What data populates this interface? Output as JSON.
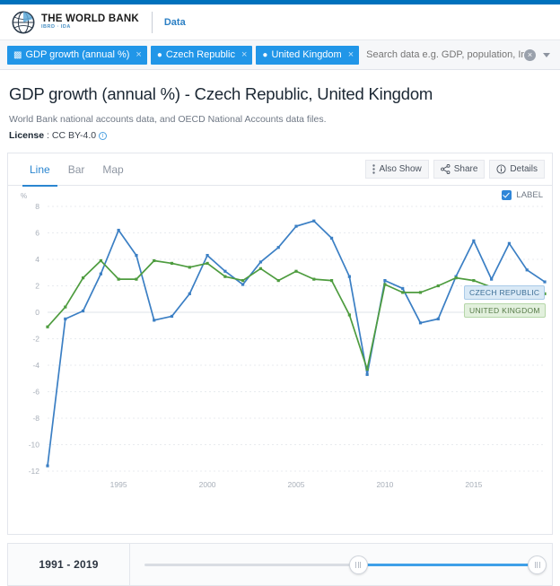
{
  "brand": {
    "logo_icon": "world-bank-globe-icon",
    "title": "THE WORLD BANK",
    "subtitle": "IBRD · IDA",
    "data_link": "Data"
  },
  "search": {
    "tokens": [
      {
        "icon": "bar-chart-icon",
        "label": "GDP growth (annual %)",
        "remove": "×"
      },
      {
        "icon": "location-pin-icon",
        "label": "Czech Republic",
        "remove": "×"
      },
      {
        "icon": "location-pin-icon",
        "label": "United Kingdom",
        "remove": "×"
      }
    ],
    "placeholder": "Search data e.g. GDP, population, India",
    "value": "",
    "clear_label": "×",
    "accent": "#2196e8"
  },
  "heading": {
    "title": "GDP growth (annual %) - Czech Republic, United Kingdom",
    "source": "World Bank national accounts data, and OECD National Accounts data files.",
    "license_label": "License",
    "license_sep": " : ",
    "license_value": "CC BY-4.0",
    "info_icon": "info-icon"
  },
  "card": {
    "tabs": [
      {
        "label": "Line",
        "active": true
      },
      {
        "label": "Bar",
        "active": false
      },
      {
        "label": "Map",
        "active": false
      }
    ],
    "toolbar": [
      {
        "label": "Also Show",
        "icon": "kebab-menu-icon"
      },
      {
        "label": "Share",
        "icon": "share-icon"
      },
      {
        "label": "Details",
        "icon": "info-circle-icon"
      }
    ],
    "label_toggle": {
      "label": "LABEL",
      "checked": true
    }
  },
  "footer": {
    "range_label": "1991 - 2019",
    "slider": {
      "min_year": 1991,
      "max_year": 2019,
      "left_handle_pct": 54,
      "right_handle_pct": 100
    }
  },
  "chart_data": {
    "type": "line",
    "title": "GDP growth (annual %) - Czech Republic, United Kingdom",
    "xlabel": "",
    "ylabel": "%",
    "unit": "%",
    "xlim": [
      1991,
      2019
    ],
    "ylim": [
      -12,
      8
    ],
    "yticks": [
      8,
      6,
      4,
      2,
      0,
      -2,
      -4,
      -6,
      -8,
      -10,
      -12
    ],
    "xticks": [
      1995,
      2000,
      2005,
      2010,
      2015
    ],
    "grid": true,
    "legend": "inline-series-labels",
    "x": [
      1991,
      1992,
      1993,
      1994,
      1995,
      1996,
      1997,
      1998,
      1999,
      2000,
      2001,
      2002,
      2003,
      2004,
      2005,
      2006,
      2007,
      2008,
      2009,
      2010,
      2011,
      2012,
      2013,
      2014,
      2015,
      2016,
      2017,
      2018,
      2019
    ],
    "series": [
      {
        "name": "Czech Republic",
        "color": "#3b7fc4",
        "label": "CZECH REPUBLIC",
        "values": [
          -11.6,
          -0.5,
          0.1,
          2.9,
          6.2,
          4.3,
          -0.6,
          -0.3,
          1.4,
          4.3,
          3.1,
          2.1,
          3.8,
          4.9,
          6.5,
          6.9,
          5.6,
          2.7,
          -4.7,
          2.4,
          1.8,
          -0.8,
          -0.5,
          2.7,
          5.4,
          2.5,
          5.2,
          3.2,
          2.3
        ]
      },
      {
        "name": "United Kingdom",
        "color": "#4e9c3f",
        "label": "UNITED KINGDOM",
        "values": [
          -1.1,
          0.4,
          2.6,
          3.9,
          2.5,
          2.5,
          3.9,
          3.7,
          3.4,
          3.7,
          2.7,
          2.4,
          3.3,
          2.4,
          3.1,
          2.5,
          2.4,
          -0.2,
          -4.3,
          2.1,
          1.5,
          1.5,
          2.0,
          2.6,
          2.4,
          1.9,
          1.9,
          1.3,
          1.4
        ]
      }
    ]
  }
}
